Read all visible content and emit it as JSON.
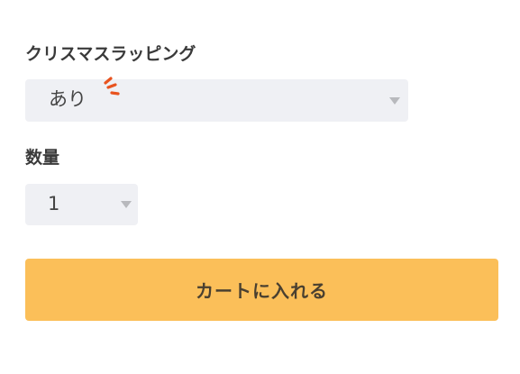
{
  "gift_wrapping": {
    "label": "クリスマスラッピング",
    "selected": "あり"
  },
  "quantity": {
    "label": "数量",
    "selected": "1"
  },
  "add_to_cart": {
    "label": "カートに入れる"
  },
  "colors": {
    "select_bg": "#eff0f4",
    "button_bg": "#fbbf59",
    "accent_marks": "#e8531f"
  },
  "icons": {
    "dropdown": "caret-down-icon",
    "decoration": "sparkle-lines-icon"
  }
}
